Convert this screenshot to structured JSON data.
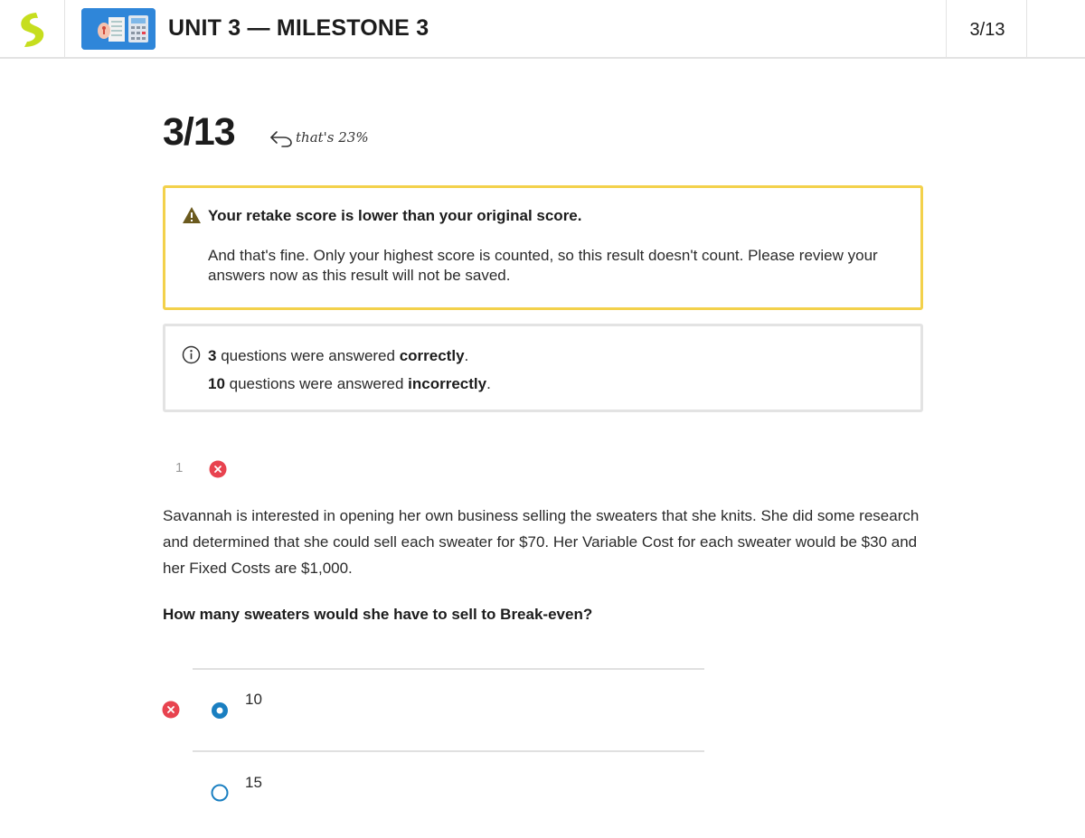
{
  "header": {
    "logo_icon": "sophia-logo-icon",
    "thumbnail_icon": "calculator-notebook-icon",
    "title": "UNIT 3 — MILESTONE 3",
    "score": "3/13"
  },
  "result": {
    "score": "3/13",
    "percent_note": "that's 23%",
    "percent": 23
  },
  "warning": {
    "icon": "warning-triangle-icon",
    "title": "Your retake score is lower than your original score.",
    "body": "And that's fine. Only your highest score is counted, so this result doesn't count. Please review your answers now as this result will not be saved."
  },
  "summary": {
    "icon": "info-icon",
    "correct_count": "3",
    "correct_pre": " questions were answered ",
    "correct_word": "correctly",
    "incorrect_count": "10",
    "incorrect_pre": " questions were answered ",
    "incorrect_word": "incorrectly",
    "period": "."
  },
  "question": {
    "number": "1",
    "status": "incorrect",
    "text": "Savannah is interested in opening her own business selling the sweaters that she knits. She did some research and determined that she could sell each sweater for $70. Her Variable Cost for each sweater would be $30 and her Fixed Costs are $1,000.",
    "prompt": "How many sweaters would she have to sell to Break-even?",
    "answers": [
      {
        "label": "10",
        "selected": true,
        "marked": "incorrect"
      },
      {
        "label": "15",
        "selected": false,
        "marked": ""
      }
    ]
  },
  "colors": {
    "accent_blue": "#1a7fc1",
    "error_red": "#e8434f",
    "warning_yellow": "#f3d14b",
    "logo_green": "#c6de1e"
  }
}
